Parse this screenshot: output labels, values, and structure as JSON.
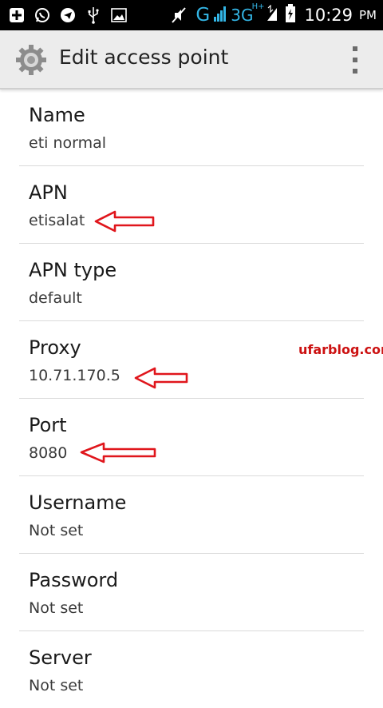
{
  "status_bar": {
    "icons": [
      "notification-plus-icon",
      "whatsapp-icon",
      "telegram-icon",
      "usb-icon",
      "image-icon",
      "mute-icon"
    ],
    "network_g": "G",
    "network_3g": "3G",
    "network_3g_sup": "H+",
    "time": "10:29",
    "ampm": "PM"
  },
  "action_bar": {
    "title": "Edit access point",
    "icon": "gear-icon",
    "overflow_icon": "overflow-menu-icon"
  },
  "settings": [
    {
      "label": "Name",
      "value": "eti normal"
    },
    {
      "label": "APN",
      "value": "etisalat"
    },
    {
      "label": "APN type",
      "value": "default"
    },
    {
      "label": "Proxy",
      "value": "10.71.170.5"
    },
    {
      "label": "Port",
      "value": "8080"
    },
    {
      "label": "Username",
      "value": "Not set"
    },
    {
      "label": "Password",
      "value": "Not set"
    },
    {
      "label": "Server",
      "value": "Not set"
    }
  ],
  "watermark": "ufarblog.com",
  "colors": {
    "status_bar_bg": "#000000",
    "network_accent": "#33b5e5",
    "action_bar_bg": "#ececec",
    "annotation_red": "#e0161c"
  }
}
